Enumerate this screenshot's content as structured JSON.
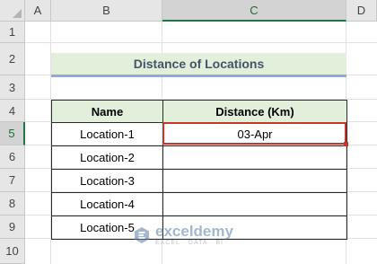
{
  "columns": [
    "A",
    "B",
    "C",
    "D"
  ],
  "active_column": "C",
  "rows": [
    "1",
    "2",
    "3",
    "4",
    "5",
    "6",
    "7",
    "8",
    "9",
    "10"
  ],
  "active_row": "5",
  "title": "Distance of Locations",
  "table": {
    "headers": [
      "Name",
      "Distance (Km)"
    ],
    "rows": [
      [
        "Location-1",
        "03-Apr"
      ],
      [
        "Location-2",
        ""
      ],
      [
        "Location-3",
        ""
      ],
      [
        "Location-4",
        ""
      ],
      [
        "Location-5",
        ""
      ]
    ]
  },
  "selected_cell": "C5",
  "watermark": {
    "name": "exceldemy",
    "tagline": "EXCEL · DATA · BI"
  },
  "colors": {
    "title_fill": "#e2efda",
    "header_fill": "#e2efda",
    "title_text": "#44546a",
    "title_underline": "#8ea9db",
    "selection_border": "#c0392b",
    "active_header_accent": "#217346"
  }
}
